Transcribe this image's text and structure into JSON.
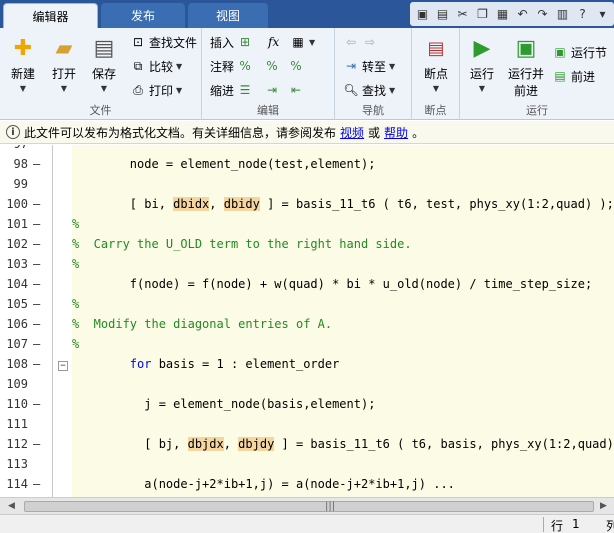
{
  "tabs": [
    {
      "label": "编辑器"
    },
    {
      "label": "发布"
    },
    {
      "label": "视图"
    }
  ],
  "ribbon": {
    "file": {
      "new": "新建",
      "open": "打开",
      "save": "保存",
      "find_files": "查找文件",
      "compare": "比较",
      "print": "打印",
      "group": "文件"
    },
    "edit": {
      "insert": "插入",
      "comment": "注释",
      "indent": "缩进",
      "group": "编辑",
      "fx": "fx"
    },
    "navigate": {
      "goto": "转至",
      "find": "查找",
      "group": "导航"
    },
    "breakpoints": {
      "breakpoints": "断点",
      "group": "断点"
    },
    "run": {
      "run": "运行",
      "run_advance_1": "运行并",
      "run_advance_2": "前进",
      "run_section": "运行节",
      "advance": "前进",
      "group": "运行"
    }
  },
  "info": {
    "text": "此文件可以发布为格式化文档。有关详细信息，请参阅发布",
    "link1": "视频",
    "or": "或",
    "link2": "帮助",
    "end": "。"
  },
  "code": {
    "lines": [
      {
        "n": "97",
        "text": ""
      },
      {
        "n": "98",
        "text": "        node = element_node(test,element);"
      },
      {
        "n": "99",
        "text": ""
      },
      {
        "n": "100",
        "text": "        [ bi, dbidx, dbidy ] = basis_11_t6 ( t6, test, phys_xy(1:2,quad) );"
      },
      {
        "n": "101",
        "text": "%"
      },
      {
        "n": "102",
        "text": "%  Carry the U_OLD term to the right hand side."
      },
      {
        "n": "103",
        "text": "%"
      },
      {
        "n": "104",
        "text": "        f(node) = f(node) + w(quad) * bi * u_old(node) / time_step_size;"
      },
      {
        "n": "105",
        "text": "%"
      },
      {
        "n": "106",
        "text": "%  Modify the diagonal entries of A."
      },
      {
        "n": "107",
        "text": "%"
      },
      {
        "n": "108",
        "text": "        for basis = 1 : element_order"
      },
      {
        "n": "109",
        "text": ""
      },
      {
        "n": "110",
        "text": "          j = element_node(basis,element);"
      },
      {
        "n": "111",
        "text": ""
      },
      {
        "n": "112",
        "text": "          [ bj, dbjdx, dbjdy ] = basis_11_t6 ( t6, basis, phys_xy(1:2,quad) )"
      },
      {
        "n": "113",
        "text": ""
      },
      {
        "n": "114",
        "text": "          a(node-j+2*ib+1,j) = a(node-j+2*ib+1,j) ..."
      }
    ]
  },
  "status": {
    "row_label": "行",
    "row": "1",
    "col_label": "列"
  },
  "colors": {
    "accent": "#2b579a",
    "ribbon_bg": "#eef3fa",
    "code_bg": "#fbfbe6",
    "comment": "#228b22",
    "keyword": "#0000ff"
  }
}
